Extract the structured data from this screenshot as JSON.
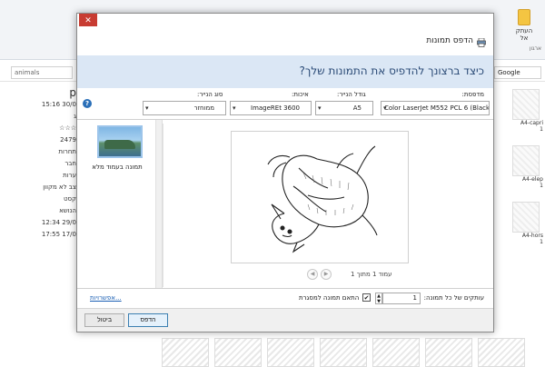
{
  "background": {
    "search_text": "animals",
    "google_text": "Google",
    "copy_label_line1": "העתק",
    "copy_label_line2": "אל",
    "misc_label": "ארגון",
    "left_column": [
      "p",
      "15:16 30/0",
      "ג",
      "☆☆☆",
      "2479",
      "תחרות",
      "חבר",
      "ערות",
      "צב לא מקוון",
      "קסט",
      "הנושא",
      "12:34 29/0",
      "17:55 17/0"
    ],
    "right_labels": [
      "A4-capri\n1",
      "A4-elep\n1",
      "A4-hors\n1"
    ]
  },
  "dialog": {
    "close_label": "✕",
    "title": "הדפס תמונות",
    "question": "כיצד ברצונך להדפיס את התמונות שלך?",
    "fields": {
      "printer_label": "מדפסת:",
      "printer_value": "Color LaserJet M552 PCL 6 (Black)",
      "paper_size_label": "גודל הנייר:",
      "paper_size_value": "A5",
      "quality_label": "איכות:",
      "quality_value": "ImageREt 3600",
      "paper_type_label": "סוג הנייר:",
      "paper_type_value": "ממוחזר"
    },
    "layout_label": "תמונה בעמוד מלא",
    "page_count": "עמוד 1 מתוך 1",
    "copies_label": "עותקים של כל תמונה:",
    "copies_value": "1",
    "fit_label": "התאם תמונה למסגרת",
    "fit_checked": "✔",
    "options_link": "אפשרויות...",
    "print_label": "הדפס",
    "cancel_label": "ביטול"
  },
  "icons": {
    "printer": "printer-icon",
    "help": "help-icon",
    "prev": "◀",
    "next": "▶",
    "spin_up": "▲",
    "spin_down": "▼",
    "dropdown": "▾"
  },
  "colors": {
    "header_bg": "#dbe7f5",
    "close_red": "#c83c32",
    "link_blue": "#1a5fb4"
  }
}
